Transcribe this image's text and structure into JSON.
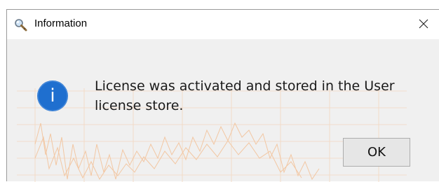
{
  "window": {
    "title": "Information",
    "title_icon": "magnifier-key-icon",
    "close_glyph": "✕"
  },
  "dialog": {
    "icon": "info-icon",
    "icon_glyph": "i",
    "message": "License was activated and stored in the User license store.",
    "ok_label": "OK"
  },
  "colors": {
    "dialog_bg": "#f0f0f0",
    "info_icon_bg": "#1f6fcf",
    "background_chart_line": "#f3c9a6"
  }
}
